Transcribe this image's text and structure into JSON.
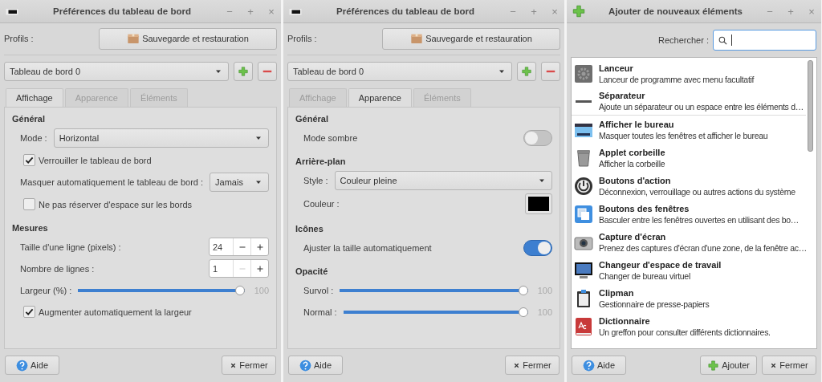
{
  "windows": [
    {
      "kind": "prefs",
      "title": "Préférences du tableau de bord",
      "title_buttons": [
        "−",
        "+",
        "×"
      ],
      "profiles_label": "Profils :",
      "backup_button": "Sauvegarde et restauration",
      "panel_select": "Tableau de bord 0",
      "tabs": [
        {
          "label": "Affichage",
          "selected": true
        },
        {
          "label": "Apparence",
          "selected": false
        },
        {
          "label": "Éléments",
          "selected": false
        }
      ],
      "sections": [
        {
          "heading": "Général",
          "rows": [
            {
              "kind": "select",
              "label": "Mode :",
              "value": "Horizontal"
            },
            {
              "kind": "checkbox",
              "label": "Verrouiller le tableau de bord",
              "checked": true
            },
            {
              "kind": "select",
              "label": "Masquer automatiquement le tableau de bord :",
              "value": "Jamais"
            },
            {
              "kind": "checkbox",
              "label": "Ne pas réserver d'espace sur les bords",
              "checked": false
            }
          ]
        },
        {
          "heading": "Mesures",
          "rows": [
            {
              "kind": "spin",
              "label": "Taille d'une ligne (pixels) :",
              "value": "24",
              "minus_disabled": false
            },
            {
              "kind": "spin",
              "label": "Nombre de lignes :",
              "value": "1",
              "minus_disabled": true
            },
            {
              "kind": "slider",
              "label": "Largeur (%) :",
              "level": 1,
              "reading": "100"
            },
            {
              "kind": "checkbox",
              "label": "Augmenter automatiquement la largeur",
              "checked": true
            }
          ]
        }
      ],
      "buttons": [
        {
          "kind": "help",
          "label": "Aide"
        },
        {
          "kind": "close",
          "label": "Fermer"
        }
      ]
    },
    {
      "kind": "prefs",
      "title": "Préférences du tableau de bord",
      "title_buttons": [
        "−",
        "+",
        "×"
      ],
      "profiles_label": "Profils :",
      "backup_button": "Sauvegarde et restauration",
      "panel_select": "Tableau de bord 0",
      "tabs": [
        {
          "label": "Affichage",
          "selected": false
        },
        {
          "label": "Apparence",
          "selected": true
        },
        {
          "label": "Éléments",
          "selected": false
        }
      ],
      "sections": [
        {
          "heading": "Général",
          "rows": [
            {
              "kind": "toggle",
              "label": "Mode sombre",
              "on": false
            }
          ]
        },
        {
          "heading": "Arrière-plan",
          "rows": [
            {
              "kind": "select",
              "label": "Style :",
              "value": "Couleur pleine"
            },
            {
              "kind": "color",
              "label": "Couleur :",
              "color": "#000000"
            }
          ]
        },
        {
          "heading": "Icônes",
          "rows": [
            {
              "kind": "toggle",
              "label": "Ajuster la taille automatiquement",
              "on": true
            }
          ]
        },
        {
          "heading": "Opacité",
          "rows": [
            {
              "kind": "slider",
              "label": "Survol :",
              "level": 1,
              "reading": "100"
            },
            {
              "kind": "slider",
              "label": "Normal :",
              "level": 1,
              "reading": "100"
            }
          ]
        }
      ],
      "buttons": [
        {
          "kind": "help",
          "label": "Aide"
        },
        {
          "kind": "close",
          "label": "Fermer"
        }
      ]
    },
    {
      "kind": "add",
      "title": "Ajouter de nouveaux éléments",
      "title_buttons": [
        "−",
        "+",
        "×"
      ],
      "search": {
        "label": "Rechercher :"
      },
      "items": [
        {
          "kind": "gear",
          "name": "Lanceur",
          "description": "Lanceur de programme avec menu facultatif"
        },
        {
          "kind": "separator",
          "name": "Séparateur",
          "description": "Ajoute un séparateur ou un espace entre les éléments d…"
        },
        {
          "kind": "desktop",
          "name": "Afficher le bureau",
          "description": "Masquer toutes les fenêtres et afficher le bureau"
        },
        {
          "kind": "trash",
          "name": "Applet corbeille",
          "description": "Afficher la corbeille"
        },
        {
          "kind": "power",
          "name": "Boutons d'action",
          "description": "Déconnexion, verrouillage ou autres actions du système"
        },
        {
          "kind": "windows",
          "name": "Boutons des fenêtres",
          "description": "Basculer entre les fenêtres ouvertes en utilisant des bo…"
        },
        {
          "kind": "camera",
          "name": "Capture d'écran",
          "description": "Prenez des captures d'écran d'une zone, de la fenêtre ac…"
        },
        {
          "kind": "monitor",
          "name": "Changeur d'espace de travail",
          "description": "Changer de bureau virtuel"
        },
        {
          "kind": "clipboard",
          "name": "Clipman",
          "description": "Gestionnaire de presse-papiers"
        },
        {
          "kind": "dictionary",
          "name": "Dictionnaire",
          "description": "Un greffon pour consulter différents dictionnaires."
        }
      ],
      "buttons": [
        {
          "kind": "help",
          "label": "Aide"
        },
        {
          "kind": "add",
          "label": "Ajouter"
        },
        {
          "kind": "close",
          "label": "Fermer"
        }
      ]
    }
  ]
}
